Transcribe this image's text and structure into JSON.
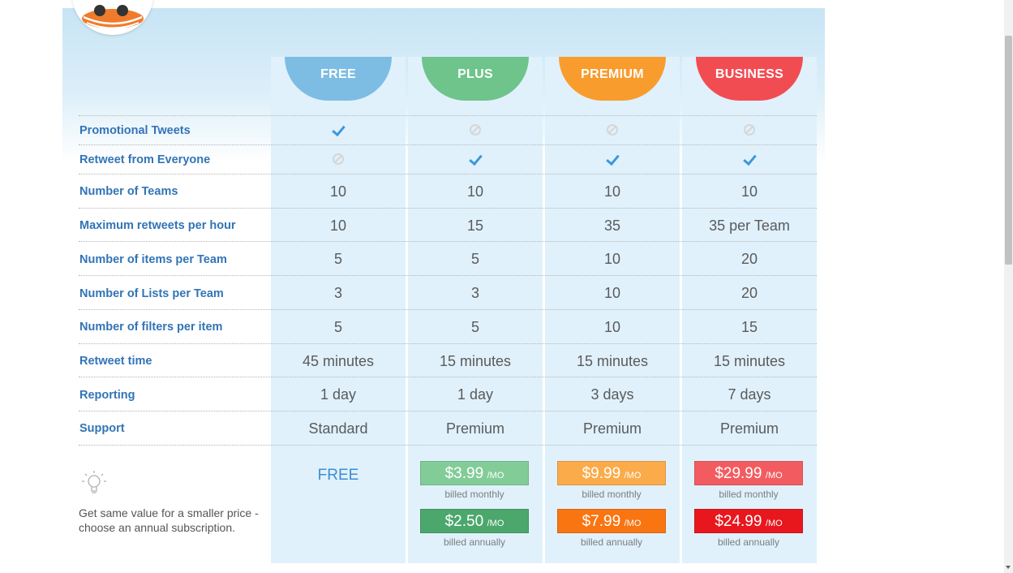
{
  "plans": [
    {
      "name": "FREE",
      "color": "#7dbde3"
    },
    {
      "name": "PLUS",
      "color": "#6ec48a"
    },
    {
      "name": "PREMIUM",
      "color": "#f89c2e"
    },
    {
      "name": "BUSINESS",
      "color": "#f24c53"
    }
  ],
  "features": [
    {
      "label": "Promotional Tweets",
      "values": [
        "check",
        "no",
        "no",
        "no"
      ]
    },
    {
      "label": "Retweet from Everyone",
      "values": [
        "no",
        "check",
        "check",
        "check"
      ]
    },
    {
      "label": "Number of Teams",
      "values": [
        "10",
        "10",
        "10",
        "10"
      ]
    },
    {
      "label": "Maximum retweets per hour",
      "values": [
        "10",
        "15",
        "35",
        "35 per Team"
      ]
    },
    {
      "label": "Number of items per Team",
      "values": [
        "5",
        "5",
        "10",
        "20"
      ]
    },
    {
      "label": "Number of Lists per Team",
      "values": [
        "3",
        "3",
        "10",
        "20"
      ]
    },
    {
      "label": "Number of filters per item",
      "values": [
        "5",
        "5",
        "10",
        "15"
      ]
    },
    {
      "label": "Retweet time",
      "values": [
        "45 minutes",
        "15 minutes",
        "15 minutes",
        "15 minutes"
      ]
    },
    {
      "label": "Reporting",
      "values": [
        "1 day",
        "1 day",
        "3 days",
        "7 days"
      ]
    },
    {
      "label": "Support",
      "values": [
        "Standard",
        "Premium",
        "Premium",
        "Premium"
      ]
    }
  ],
  "pricing": {
    "free_label": "FREE",
    "per_label": "/MO",
    "billed_monthly": "billed monthly",
    "billed_annually": "billed annually",
    "plus": {
      "monthly": "$3.99",
      "annual": "$2.50",
      "monthly_color": "#82cc98",
      "annual_color": "#4ba76b"
    },
    "premium": {
      "monthly": "$9.99",
      "annual": "$7.99",
      "monthly_color": "#fbab4a",
      "annual_color": "#f97512"
    },
    "business": {
      "monthly": "$29.99",
      "annual": "$24.99",
      "monthly_color": "#f25c60",
      "annual_color": "#e8171e"
    }
  },
  "tip": {
    "icon": "lightbulb-icon",
    "text": "Get same value for a smaller price - choose an annual subscription."
  },
  "colors": {
    "label_blue": "#3274b6",
    "column_bg": "#e0f1fc",
    "check_blue": "#3d98d8"
  }
}
